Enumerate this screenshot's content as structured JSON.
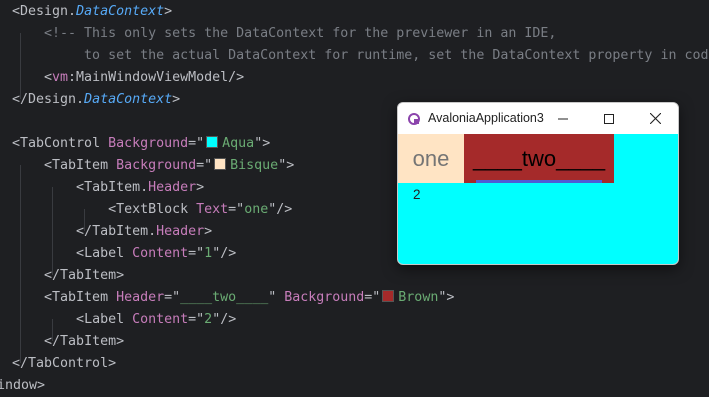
{
  "code_lines": [
    {
      "segments": [
        {
          "c": "brk",
          "t": "<"
        },
        {
          "c": "tn",
          "t": "Design."
        },
        {
          "c": "it",
          "t": "DataContext"
        },
        {
          "c": "brk",
          "t": ">"
        }
      ]
    },
    {
      "segments": [
        {
          "c": "cm",
          "t": "    <!-- This only sets the DataContext for the previewer in an IDE,"
        }
      ]
    },
    {
      "segments": [
        {
          "c": "cm",
          "t": "         to set the actual DataContext for runtime, set the DataContext property in code"
        }
      ]
    },
    {
      "segments": [
        {
          "c": "brk",
          "t": "    <"
        },
        {
          "c": "ns",
          "t": "vm"
        },
        {
          "c": "tn",
          "t": ":MainWindowViewModel"
        },
        {
          "c": "brk",
          "t": "/>"
        }
      ]
    },
    {
      "segments": [
        {
          "c": "brk",
          "t": "</"
        },
        {
          "c": "tn",
          "t": "Design."
        },
        {
          "c": "it",
          "t": "DataContext"
        },
        {
          "c": "brk",
          "t": ">"
        }
      ]
    },
    {
      "segments": []
    },
    {
      "segments": [
        {
          "c": "brk",
          "t": "<"
        },
        {
          "c": "tn",
          "t": "TabControl "
        },
        {
          "c": "ap",
          "t": "Background"
        },
        {
          "c": "brk",
          "t": "=\""
        },
        {
          "c": "swatch",
          "t": "#00ffff"
        },
        {
          "c": "sv",
          "t": "Aqua"
        },
        {
          "c": "brk",
          "t": "\">"
        }
      ]
    },
    {
      "segments": [
        {
          "c": "brk",
          "t": "    <"
        },
        {
          "c": "tn",
          "t": "TabItem "
        },
        {
          "c": "ap",
          "t": "Background"
        },
        {
          "c": "brk",
          "t": "=\""
        },
        {
          "c": "swatch",
          "t": "#ffe4c4"
        },
        {
          "c": "sv",
          "t": "Bisque"
        },
        {
          "c": "brk",
          "t": "\">"
        }
      ]
    },
    {
      "segments": [
        {
          "c": "brk",
          "t": "        <"
        },
        {
          "c": "tn",
          "t": "TabItem."
        },
        {
          "c": "ap",
          "t": "Header"
        },
        {
          "c": "brk",
          "t": ">"
        }
      ]
    },
    {
      "segments": [
        {
          "c": "brk",
          "t": "            <"
        },
        {
          "c": "tn",
          "t": "TextBlock "
        },
        {
          "c": "ap",
          "t": "Text"
        },
        {
          "c": "brk",
          "t": "=\""
        },
        {
          "c": "sv",
          "t": "one"
        },
        {
          "c": "brk",
          "t": "\"/>"
        }
      ]
    },
    {
      "segments": [
        {
          "c": "brk",
          "t": "        </"
        },
        {
          "c": "tn",
          "t": "TabItem."
        },
        {
          "c": "ap",
          "t": "Header"
        },
        {
          "c": "brk",
          "t": ">"
        }
      ]
    },
    {
      "segments": [
        {
          "c": "brk",
          "t": "        <"
        },
        {
          "c": "tn",
          "t": "Label "
        },
        {
          "c": "ap",
          "t": "Content"
        },
        {
          "c": "brk",
          "t": "=\""
        },
        {
          "c": "sv",
          "t": "1"
        },
        {
          "c": "brk",
          "t": "\"/>"
        }
      ]
    },
    {
      "segments": [
        {
          "c": "brk",
          "t": "    </"
        },
        {
          "c": "tn",
          "t": "TabItem"
        },
        {
          "c": "brk",
          "t": ">"
        }
      ]
    },
    {
      "segments": [
        {
          "c": "brk",
          "t": "    <"
        },
        {
          "c": "tn",
          "t": "TabItem "
        },
        {
          "c": "ap",
          "t": "Header"
        },
        {
          "c": "brk",
          "t": "=\""
        },
        {
          "c": "sv",
          "t": "____two____"
        },
        {
          "c": "brk",
          "t": "\" "
        },
        {
          "c": "ap",
          "t": "Background"
        },
        {
          "c": "brk",
          "t": "=\""
        },
        {
          "c": "swatch",
          "t": "#a52a2a"
        },
        {
          "c": "sv",
          "t": "Brown"
        },
        {
          "c": "brk",
          "t": "\">"
        }
      ]
    },
    {
      "segments": [
        {
          "c": "brk",
          "t": "        <"
        },
        {
          "c": "tn",
          "t": "Label "
        },
        {
          "c": "ap",
          "t": "Content"
        },
        {
          "c": "brk",
          "t": "=\""
        },
        {
          "c": "sv",
          "t": "2"
        },
        {
          "c": "brk",
          "t": "\"/>"
        }
      ]
    },
    {
      "segments": [
        {
          "c": "brk",
          "t": "    </"
        },
        {
          "c": "tn",
          "t": "TabItem"
        },
        {
          "c": "brk",
          "t": ">"
        }
      ]
    },
    {
      "segments": [
        {
          "c": "brk",
          "t": "</"
        },
        {
          "c": "tn",
          "t": "TabControl"
        },
        {
          "c": "brk",
          "t": ">"
        }
      ]
    },
    {
      "segments": [
        {
          "c": "tn",
          "t": "Window"
        },
        {
          "c": "brk",
          "t": ">"
        }
      ]
    }
  ],
  "preview_window": {
    "title": "AvaloniaApplication3",
    "tabs": [
      {
        "label": "one",
        "background": "#ffe4c4"
      },
      {
        "label": "____two____",
        "background": "#a52a2a"
      }
    ],
    "selected_tab_content": "2",
    "content_background": "#00ffff",
    "selection_indicator": "#4f5bd5"
  }
}
